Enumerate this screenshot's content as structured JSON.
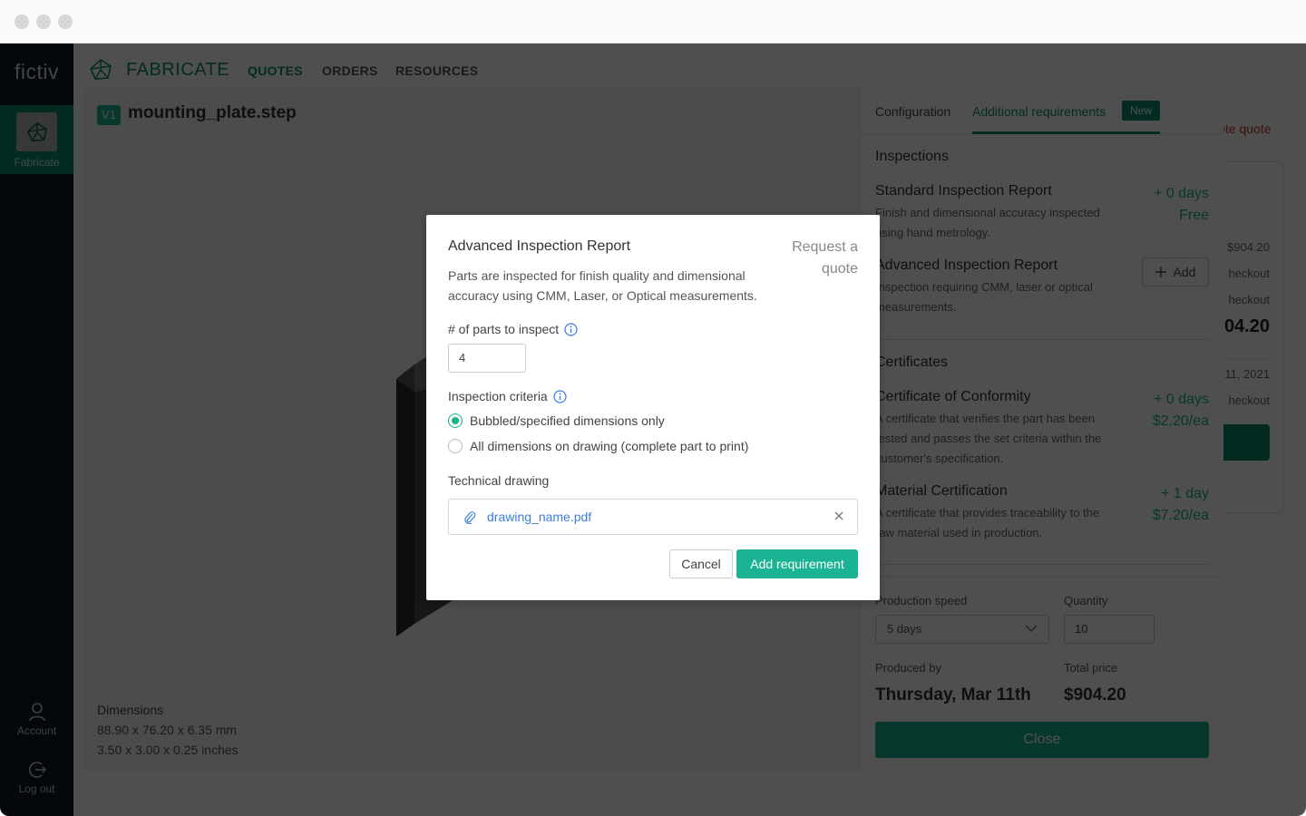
{
  "window": {
    "controls": [
      "close",
      "minimize",
      "maximize"
    ]
  },
  "sidebar": {
    "logo": "fictiv",
    "items": [
      {
        "label": "Fabricate",
        "icon": "fabricate-icon",
        "active": true
      },
      {
        "label": "Account",
        "icon": "user-icon"
      },
      {
        "label": "Log out",
        "icon": "logout-icon"
      }
    ]
  },
  "topnav": {
    "brand": "FABRICATE",
    "links": [
      {
        "label": "QUOTES",
        "active": true
      },
      {
        "label": "ORDERS"
      },
      {
        "label": "RESOURCES"
      }
    ]
  },
  "background_quote": {
    "delete_label": "lete quote",
    "lines": [
      "$904.20",
      "heckout",
      "heckout",
      "04.20",
      "11, 2021",
      "heckout"
    ]
  },
  "part_modal": {
    "version": "V1",
    "filename": "mounting_plate.step",
    "dimensions": {
      "label": "Dimensions",
      "mm": "88.90 x 76.20 x 6.35 mm",
      "inches": "3.50 x 3.00 x 0.25 inches"
    },
    "tabs": [
      {
        "label": "Configuration"
      },
      {
        "label": "Additional requirements",
        "active": true,
        "badge": "New"
      }
    ],
    "inspections": {
      "title": "Inspections",
      "items": [
        {
          "title": "Standard Inspection Report",
          "desc": "Finish and dimensional accuracy inspected using hand metrology.",
          "days": "+ 0 days",
          "price": "Free"
        },
        {
          "title": "Advanced Inspection Report",
          "desc": "Inspection requiring CMM, laser or optical measurements.",
          "action": "Add"
        }
      ]
    },
    "certificates": {
      "title": "Certificates",
      "items": [
        {
          "title": "Certificate of Conformity",
          "desc": "A certificate that verifies the part has been tested and passes the set criteria within the customer's specification.",
          "days": "+ 0 days",
          "price": "$2.20/ea"
        },
        {
          "title": "Material Certification",
          "desc": "A certificate that provides traceability to the raw material used in production.",
          "days": "+ 1 day",
          "price": "$7.20/ea"
        }
      ]
    },
    "production_speed": {
      "label": "Production speed",
      "value": "5 days"
    },
    "quantity": {
      "label": "Quantity",
      "value": "10"
    },
    "produced_by": {
      "label": "Produced by",
      "value": "Thursday, Mar 11th"
    },
    "total_price": {
      "label": "Total price",
      "value": "$904.20"
    },
    "close_label": "Close"
  },
  "dialog": {
    "title": "Advanced Inspection Report",
    "request_quote": "Request a quote",
    "description": "Parts are inspected for finish quality and dimensional accuracy using CMM, Laser, or Optical measurements.",
    "parts_label": "# of parts to inspect",
    "parts_value": "4",
    "criteria_label": "Inspection criteria",
    "criteria_options": [
      {
        "label": "Bubbled/specified dimensions only",
        "checked": true
      },
      {
        "label": "All dimensions on drawing (complete part to print)",
        "checked": false
      }
    ],
    "drawing_label": "Technical drawing",
    "drawing_file": "drawing_name.pdf",
    "cancel_label": "Cancel",
    "add_label": "Add requirement"
  },
  "colors": {
    "brand": "#0e8c6e",
    "accent": "#1ab394",
    "link": "#3b7ddd",
    "danger": "#c0392b"
  }
}
